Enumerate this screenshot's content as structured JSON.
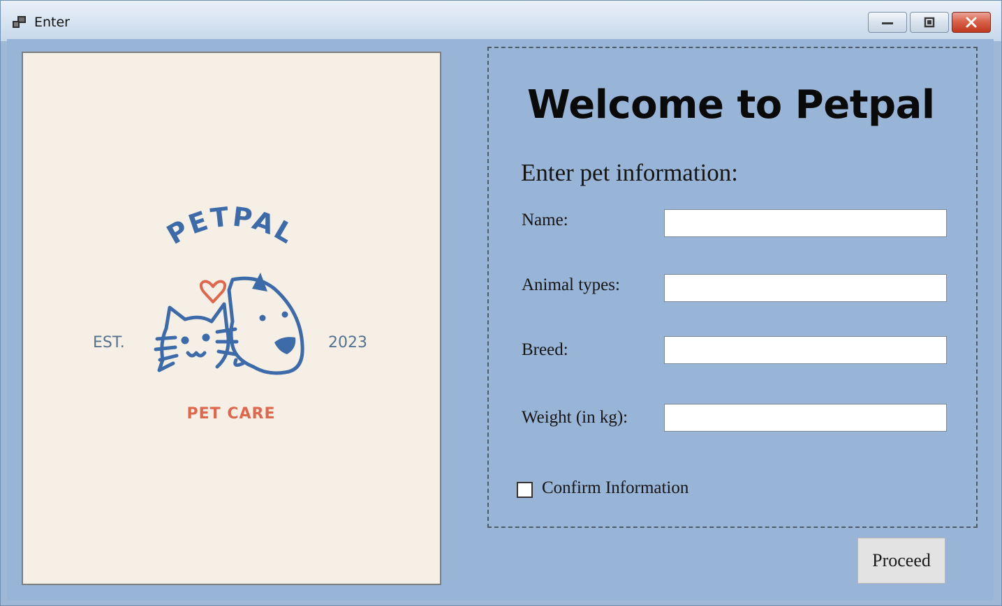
{
  "window": {
    "title": "Enter",
    "controls": {
      "minimize": "minimize",
      "maximize": "maximize",
      "close": "close"
    }
  },
  "logo": {
    "brand": "PETPAL",
    "est": "EST.",
    "year": "2023",
    "tagline": "PET CARE",
    "colors": {
      "blue": "#3d6aa8",
      "accent": "#e0664c",
      "background": "#f5efe6"
    }
  },
  "form": {
    "welcome": "Welcome to Petpal",
    "subtitle": "Enter pet information:",
    "fields": [
      {
        "label": "Name:",
        "value": ""
      },
      {
        "label": "Animal types:",
        "value": ""
      },
      {
        "label": "Breed:",
        "value": ""
      },
      {
        "label": "Weight (in kg):",
        "value": ""
      }
    ],
    "confirm_label": "Confirm Information",
    "confirm_checked": false,
    "proceed_label": "Proceed"
  },
  "colors": {
    "client_background": "#98b4d7",
    "close_button": "#c8412a"
  }
}
